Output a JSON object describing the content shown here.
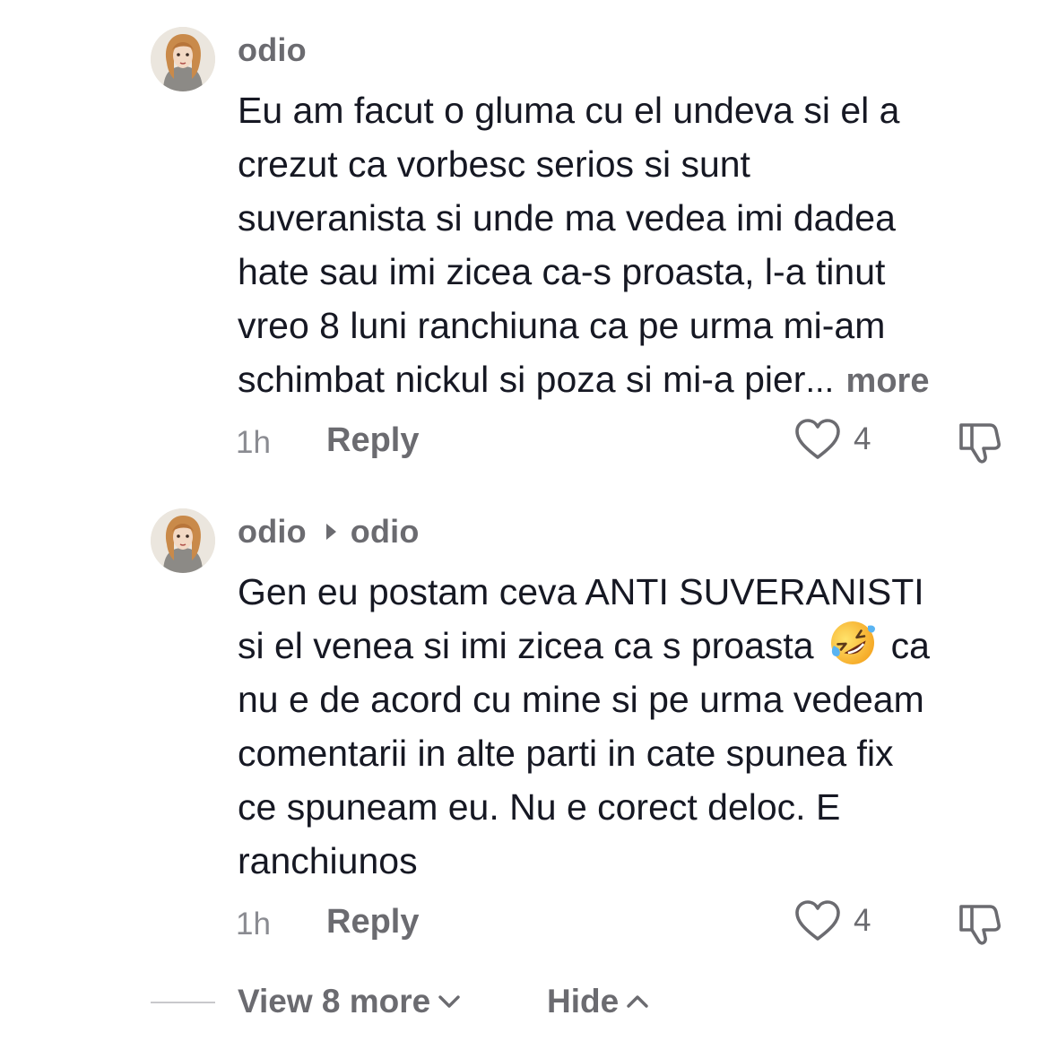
{
  "comments": [
    {
      "username": "odio",
      "reply_to": "",
      "lines": [
        "Eu am facut o gluma cu el undeva si el a",
        "crezut ca vorbesc serios si sunt",
        "suveranista si unde ma vedea imi dadea",
        "hate sau imi zicea ca-s proasta, l-a tinut",
        "vreo 8 luni ranchiuna ca pe urma mi-am",
        "schimbat nickul si poza si mi-a pier"
      ],
      "ellipsis": "...",
      "more_label": "more",
      "timestamp": "1h",
      "reply_label": "Reply",
      "like_count": "4"
    },
    {
      "username": "odio",
      "reply_to": "odio",
      "lines": [
        "Gen eu postam ceva ANTI SUVERANISTI",
        "si el venea si imi zicea ca s proasta",
        "nu e de acord cu mine si pe urma vedeam",
        "comentarii in alte parti in cate spunea fix",
        "ce spuneam eu. Nu e corect deloc. E",
        "ranchiunos"
      ],
      "line2_suffix": "ca",
      "timestamp": "1h",
      "reply_label": "Reply",
      "like_count": "4"
    }
  ],
  "footer": {
    "view_more_label": "View 8 more",
    "hide_label": "Hide"
  },
  "icons": {
    "like": "heart-outline-icon",
    "dislike": "thumbs-down-icon",
    "emoji": "rolling-on-floor-laughing-emoji",
    "view_more_chevron": "chevron-down-icon",
    "hide_chevron": "chevron-up-icon"
  },
  "colors": {
    "text": "#161823",
    "secondary": "#6b6b70",
    "muted": "#8a8b91"
  }
}
